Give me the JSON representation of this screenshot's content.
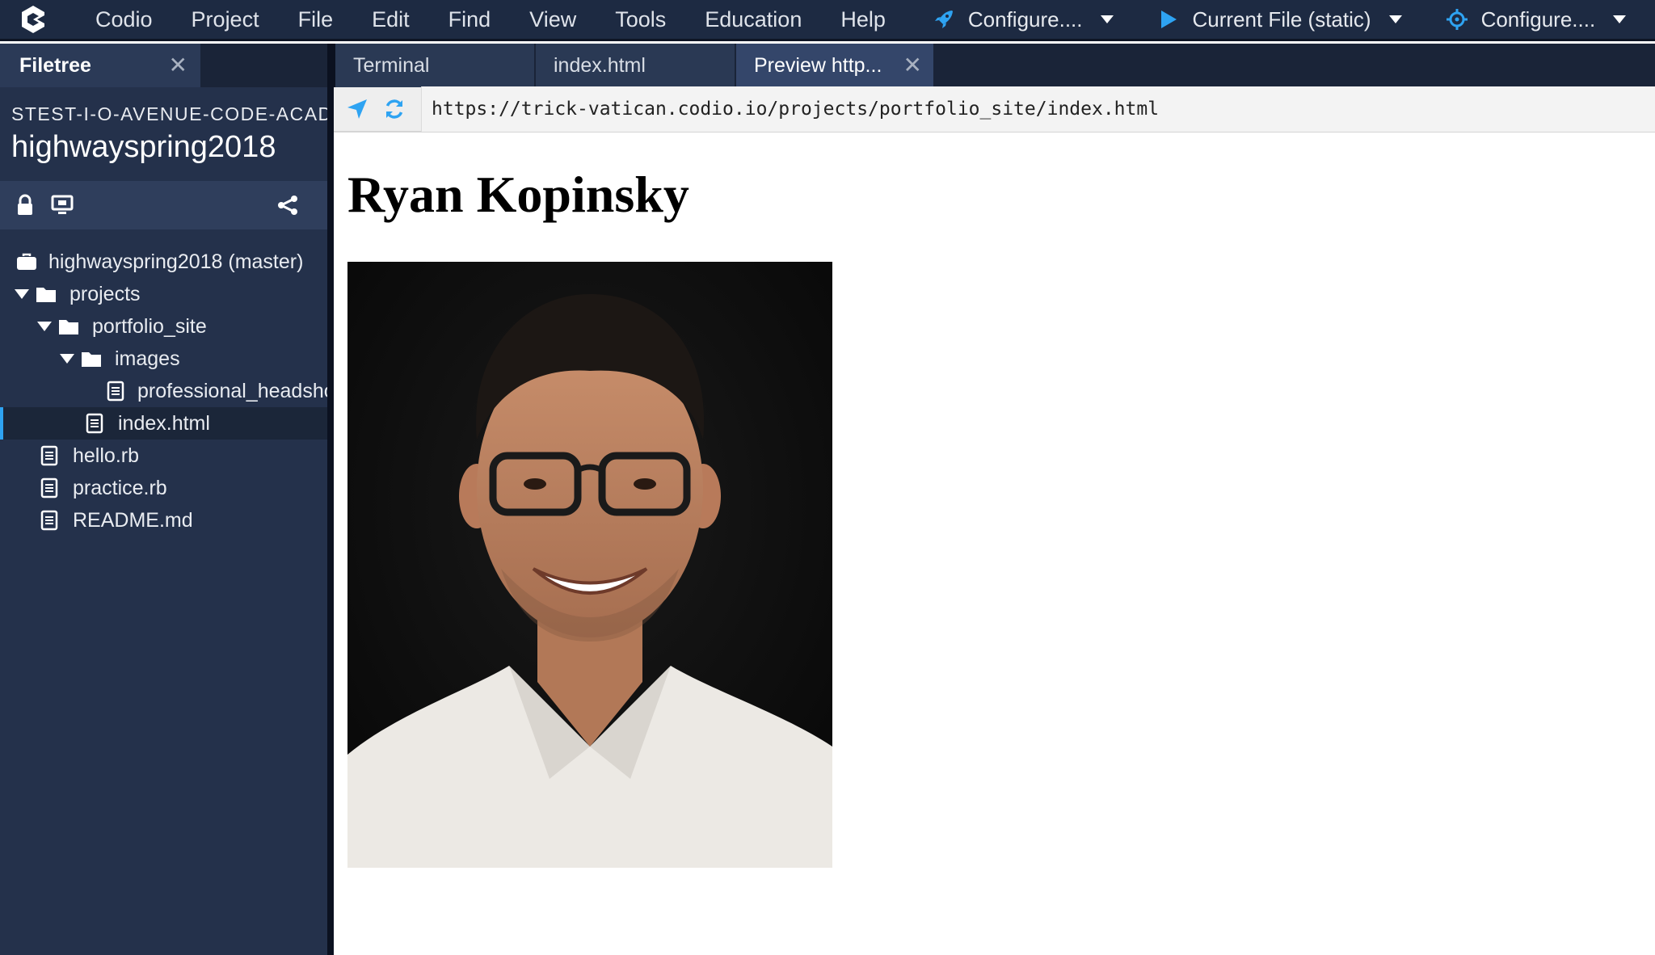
{
  "menubar": {
    "items": [
      "Codio",
      "Project",
      "File",
      "Edit",
      "Find",
      "View",
      "Tools",
      "Education",
      "Help"
    ],
    "run_buttons": [
      {
        "label": "Configure....",
        "icon": "rocket-icon"
      },
      {
        "label": "Current File (static)",
        "icon": "play-icon"
      },
      {
        "label": "Configure....",
        "icon": "target-icon"
      }
    ]
  },
  "sidebar": {
    "tab_label": "Filetree",
    "org": "STEST-I-O-AVENUE-CODE-ACADEMY",
    "project": "highwayspring2018",
    "tree": [
      {
        "label": "highwayspring2018 (master)",
        "type": "repo",
        "depth": 0
      },
      {
        "label": "projects",
        "type": "folder",
        "depth": 0
      },
      {
        "label": "portfolio_site",
        "type": "folder",
        "depth": 1
      },
      {
        "label": "images",
        "type": "folder",
        "depth": 2
      },
      {
        "label": "professional_headshot.jpg",
        "type": "file",
        "depth": 3
      },
      {
        "label": "index.html",
        "type": "file",
        "depth": 2,
        "selected": true
      },
      {
        "label": "hello.rb",
        "type": "file",
        "depth": 0
      },
      {
        "label": "practice.rb",
        "type": "file",
        "depth": 0
      },
      {
        "label": "README.md",
        "type": "file",
        "depth": 0
      }
    ]
  },
  "editor": {
    "tabs": [
      {
        "label": "Terminal"
      },
      {
        "label": "index.html"
      },
      {
        "label": "Preview http...",
        "active": true
      }
    ]
  },
  "preview": {
    "url": "https://trick-vatican.codio.io/projects/portfolio_site/index.html",
    "heading": "Ryan Kopinsky"
  },
  "colors": {
    "menubar_bg": "#1d2a42",
    "sidebar_bg": "#24314b",
    "accent_blue": "#2ea3f2",
    "selected_row_bar": "#2ea3f2"
  }
}
